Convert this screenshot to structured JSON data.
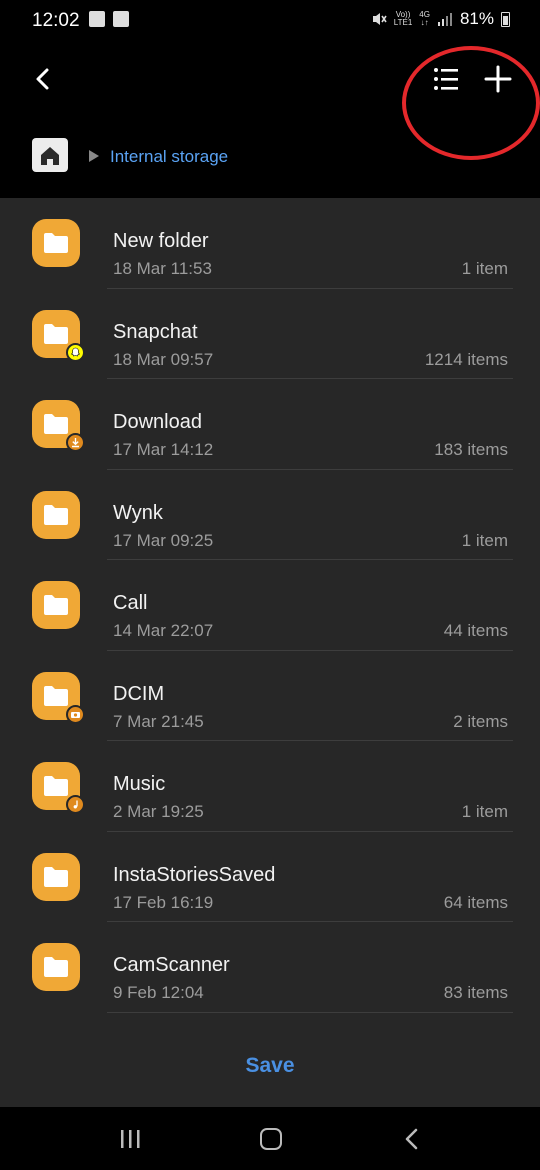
{
  "status_bar": {
    "time": "12:02",
    "network_top": "Vo))",
    "network_bottom": "LTE1",
    "gen_top": "4G",
    "gen_bottom": "↓↑",
    "battery": "81%"
  },
  "header": {
    "breadcrumb_location": "Internal storage"
  },
  "folders": [
    {
      "name": "New folder",
      "date": "18 Mar 11:53",
      "count": "1 item",
      "badge": null
    },
    {
      "name": "Snapchat",
      "date": "18 Mar 09:57",
      "count": "1214 items",
      "badge": "snapchat-ghost-icon"
    },
    {
      "name": "Download",
      "date": "17 Mar 14:12",
      "count": "183 items",
      "badge": "download-icon"
    },
    {
      "name": "Wynk",
      "date": "17 Mar 09:25",
      "count": "1 item",
      "badge": null
    },
    {
      "name": "Call",
      "date": "14 Mar 22:07",
      "count": "44 items",
      "badge": null
    },
    {
      "name": "DCIM",
      "date": "7 Mar 21:45",
      "count": "2 items",
      "badge": "camera-icon"
    },
    {
      "name": "Music",
      "date": "2 Mar 19:25",
      "count": "1 item",
      "badge": "music-note-icon"
    },
    {
      "name": "InstaStoriesSaved",
      "date": "17 Feb 16:19",
      "count": "64 items",
      "badge": null
    },
    {
      "name": "CamScanner",
      "date": "9 Feb 12:04",
      "count": "83 items",
      "badge": null
    }
  ],
  "footer": {
    "save_label": "Save"
  },
  "colors": {
    "accent": "#4a90e2",
    "breadcrumb": "#5aa3f4",
    "folder": "#f0a836",
    "annotation_circle": "#e4282b",
    "background": "#272727"
  }
}
